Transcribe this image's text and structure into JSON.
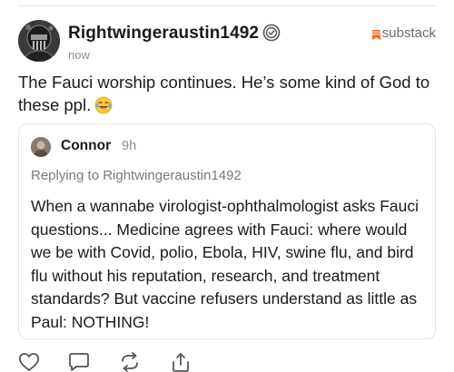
{
  "post": {
    "author": "Rightwingeraustin1492",
    "timestamp": "now",
    "source_label": "substack",
    "text": "The Fauci  worship continues.  He’s some kind of God to these ppl.",
    "emoji": "laughing-with-tears-emoji"
  },
  "quote": {
    "author": "Connor",
    "timestamp": "9h",
    "replying_to": "Replying to Rightwingeraustin1492",
    "text": "When a wannabe virologist-ophthalmologist asks Fauci questions... Medicine agrees with Fauci: where would we be with Covid, polio, Ebola, HIV, swine flu, and bird flu without his reputation, research, and treatment standards? But vaccine refusers understand as little as Paul: NOTHING!"
  },
  "actions": {
    "icons": [
      "heart-icon",
      "comment-icon",
      "restack-icon",
      "share-icon"
    ]
  },
  "colors": {
    "source_accent": "#ff6719",
    "muted_text": "#8c8c8c",
    "border": "#e3e3e3"
  }
}
